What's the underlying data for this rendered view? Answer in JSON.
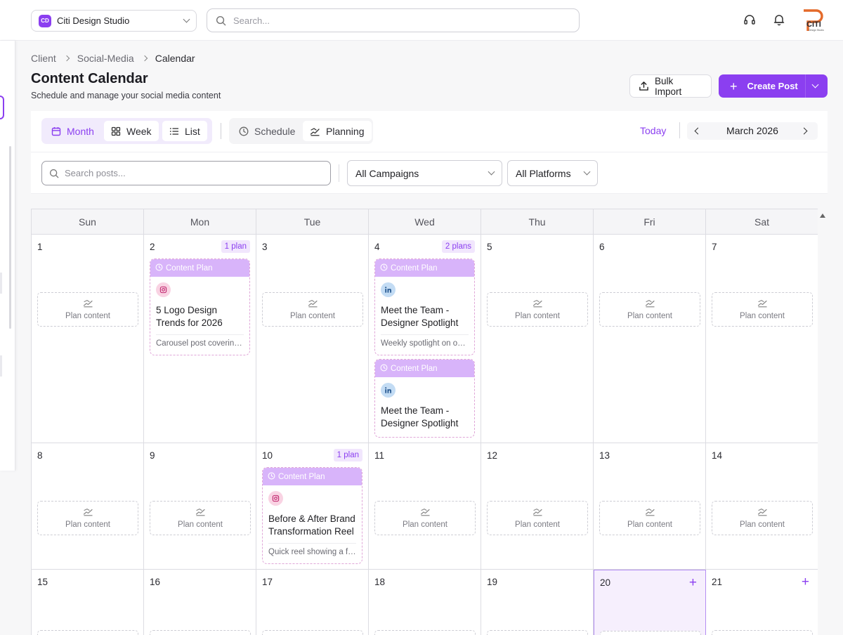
{
  "topbar": {
    "workspace_badge": "CD",
    "workspace_name": "Citi Design Studio",
    "search_placeholder": "Search...",
    "logo_text": "CITI",
    "logo_sub": "Design Studio"
  },
  "breadcrumb": [
    "Client",
    "Social-Media",
    "Calendar"
  ],
  "header": {
    "title": "Content Calendar",
    "subtitle": "Schedule and manage your social media content",
    "bulk_import": "Bulk Import",
    "create_post": "Create Post"
  },
  "toolbar": {
    "views": [
      {
        "label": "Month",
        "icon": "calendar-icon",
        "active": true
      },
      {
        "label": "Week",
        "icon": "grid-icon",
        "active": false
      },
      {
        "label": "List",
        "icon": "list-icon",
        "active": false
      }
    ],
    "modes": [
      {
        "label": "Schedule",
        "icon": "clock-icon"
      },
      {
        "label": "Planning",
        "icon": "planning-icon",
        "active": true
      }
    ],
    "today": "Today",
    "month": "March 2026"
  },
  "filters": {
    "search_placeholder": "Search posts...",
    "campaign": "All Campaigns",
    "platform": "All Platforms"
  },
  "calendar": {
    "days_of_week": [
      "Sun",
      "Mon",
      "Tue",
      "Wed",
      "Thu",
      "Fri",
      "Sat"
    ],
    "plan_slot_label": "Plan content",
    "card_label": "Content Plan",
    "weeks": [
      {
        "days": [
          {
            "num": "1",
            "slot": true
          },
          {
            "num": "2",
            "badge": "1 plan",
            "cards": [
              {
                "platform": "instagram",
                "title": "5 Logo Design Trends for 2026",
                "desc": "Carousel post covering the top design trends"
              }
            ]
          },
          {
            "num": "3",
            "slot": true
          },
          {
            "num": "4",
            "badge": "2 plans",
            "cards": [
              {
                "platform": "linkedin",
                "title": "Meet the Team - Designer Spotlight",
                "desc": "Weekly spotlight on our designers"
              },
              {
                "platform": "linkedin",
                "title": "Meet the Team - Designer Spotlight",
                "desc": ""
              }
            ]
          },
          {
            "num": "5",
            "slot": true
          },
          {
            "num": "6",
            "slot": true
          },
          {
            "num": "7",
            "slot": true
          }
        ]
      },
      {
        "days": [
          {
            "num": "8",
            "slot": true
          },
          {
            "num": "9",
            "slot": true
          },
          {
            "num": "10",
            "badge": "1 plan",
            "cards": [
              {
                "platform": "instagram",
                "title": "Before & After Brand Transformation Reel",
                "desc": "Quick reel showing a full brand transformation"
              }
            ]
          },
          {
            "num": "11",
            "slot": true
          },
          {
            "num": "12",
            "slot": true
          },
          {
            "num": "13",
            "slot": true
          },
          {
            "num": "14",
            "slot": true
          }
        ]
      },
      {
        "days": [
          {
            "num": "15",
            "slot": true
          },
          {
            "num": "16",
            "slot": true
          },
          {
            "num": "17",
            "slot": true
          },
          {
            "num": "18",
            "slot": true
          },
          {
            "num": "19",
            "slot": true
          },
          {
            "num": "20",
            "slot": true,
            "today": true,
            "plus": true
          },
          {
            "num": "21",
            "slot": true,
            "plus": true
          }
        ]
      }
    ]
  },
  "colors": {
    "accent": "#8b3ff0",
    "card_header": "#d8b4fa",
    "badge_bg": "#f1e6fd"
  }
}
